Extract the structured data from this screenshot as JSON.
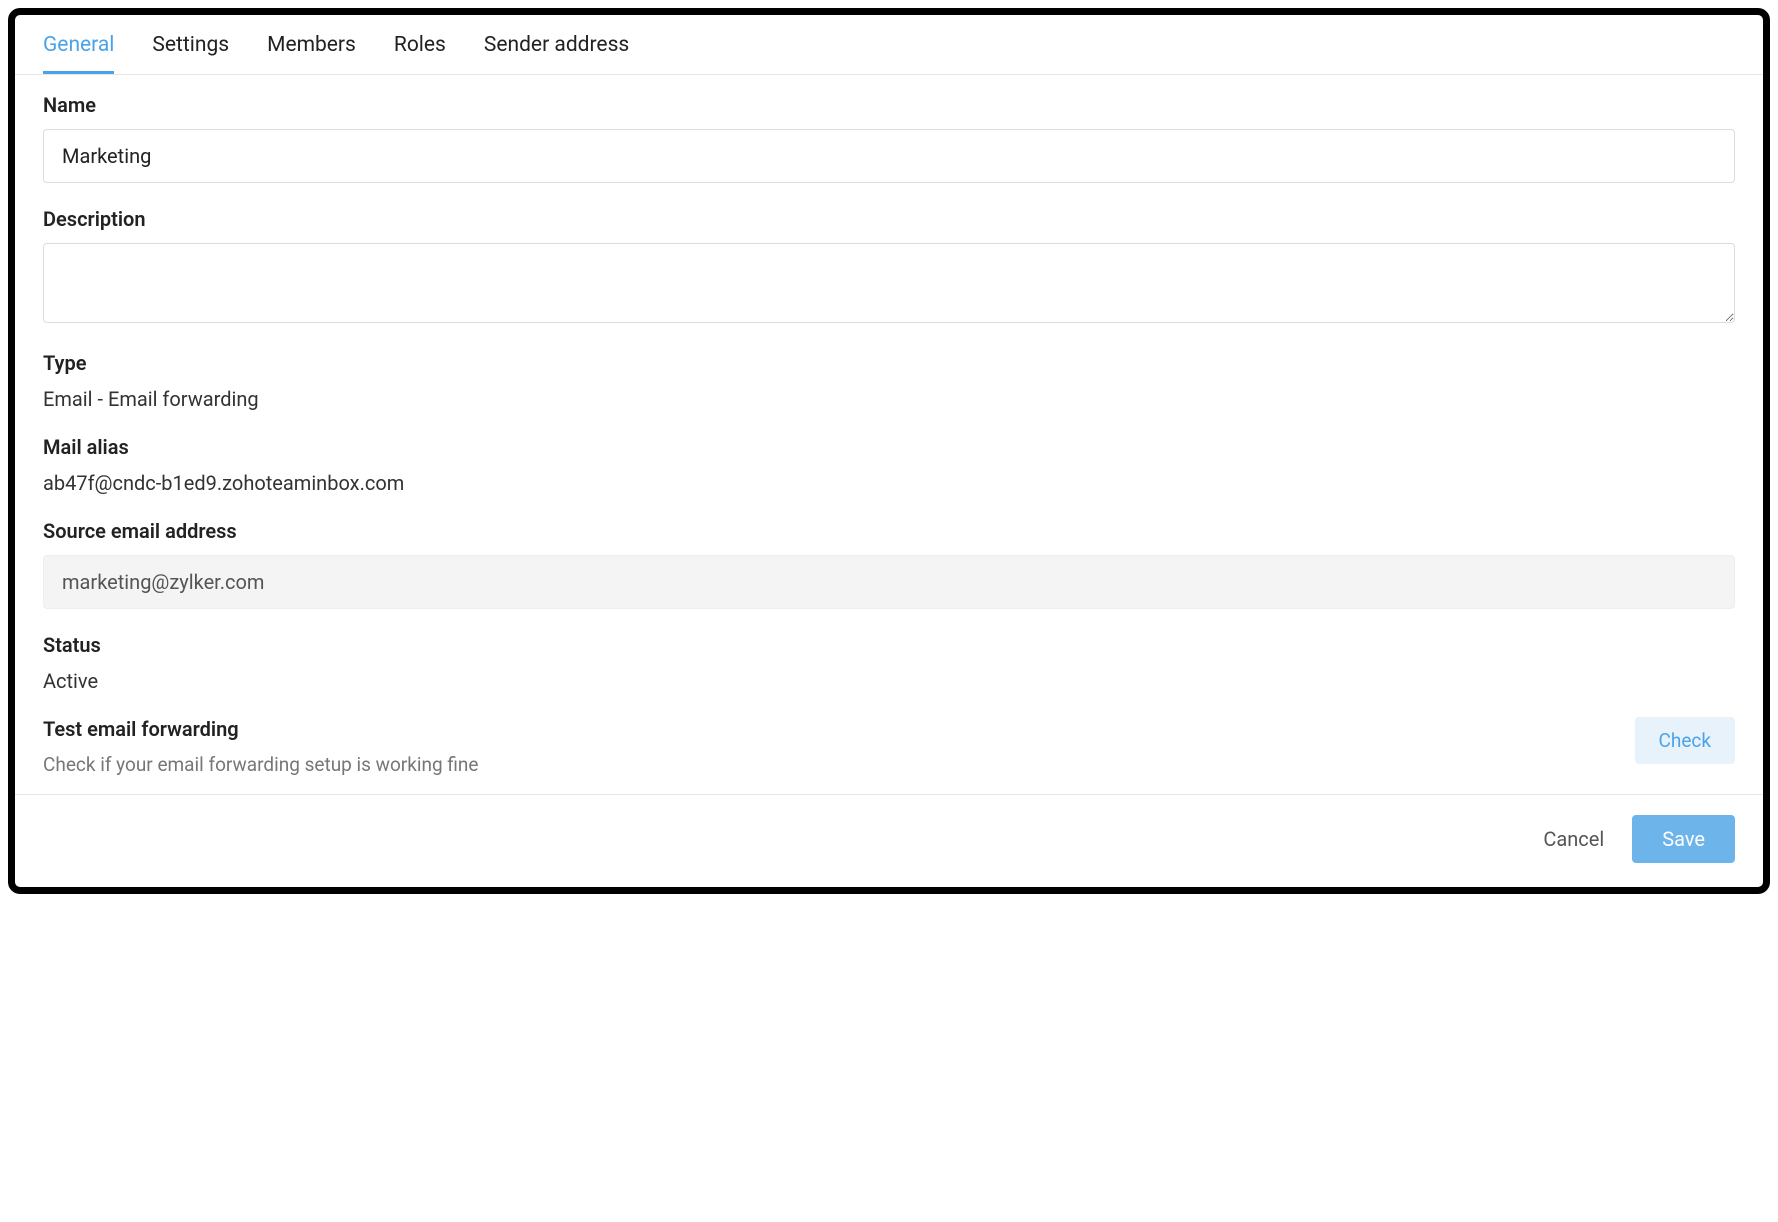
{
  "tabs": {
    "general": "General",
    "settings": "Settings",
    "members": "Members",
    "roles": "Roles",
    "sender_address": "Sender address"
  },
  "fields": {
    "name": {
      "label": "Name",
      "value": "Marketing"
    },
    "description": {
      "label": "Description",
      "value": ""
    },
    "type": {
      "label": "Type",
      "value": "Email - Email forwarding"
    },
    "mail_alias": {
      "label": "Mail alias",
      "value": "ab47f@cndc-b1ed9.zohoteaminbox.com"
    },
    "source_email": {
      "label": "Source email address",
      "value": "marketing@zylker.com"
    },
    "status": {
      "label": "Status",
      "value": "Active"
    },
    "test_forwarding": {
      "label": "Test email forwarding",
      "hint": "Check if your email forwarding setup is working fine"
    }
  },
  "buttons": {
    "check": "Check",
    "cancel": "Cancel",
    "save": "Save"
  }
}
